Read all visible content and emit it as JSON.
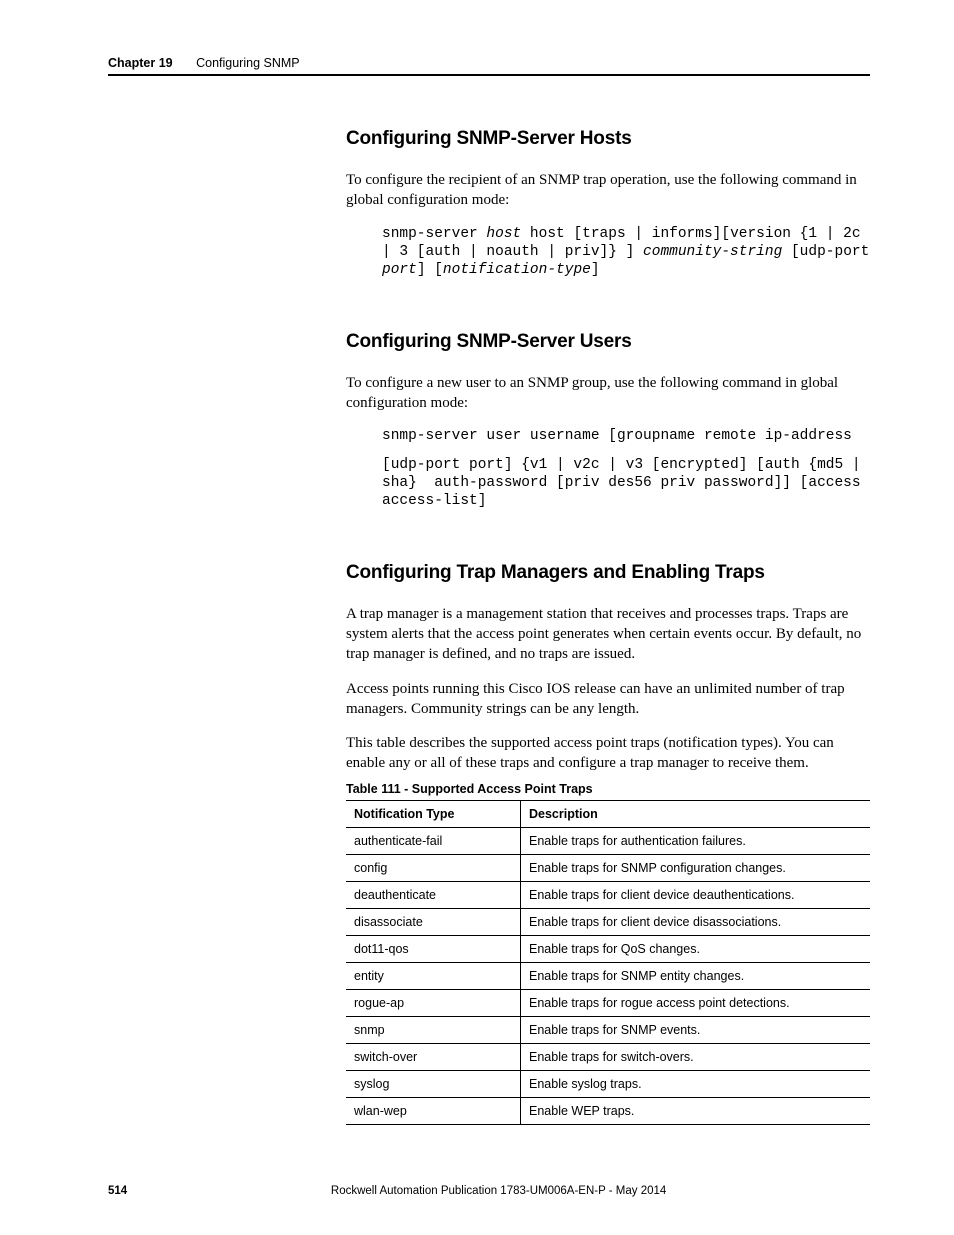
{
  "header": {
    "chapter_label": "Chapter 19",
    "chapter_title": "Configuring SNMP"
  },
  "sections": {
    "hosts": {
      "heading": "Configuring SNMP-Server Hosts",
      "intro": "To configure the recipient of an SNMP trap operation, use the following command in global configuration mode:",
      "code_plain1": "snmp-server ",
      "code_it1": "host",
      "code_plain2": " host [traps | informs][version {1 | 2c | 3 [auth | noauth | priv]} ] ",
      "code_it2": "community-string",
      "code_plain3": " [udp-port ",
      "code_it3": "port",
      "code_plain4": "] [",
      "code_it4": "notification-type",
      "code_plain5": "]"
    },
    "users": {
      "heading": "Configuring SNMP-Server Users",
      "intro": "To configure a new user to an SNMP group, use the following command in global configuration mode:",
      "code_line1": "snmp-server user username [groupname remote ip-address",
      "code_line2": "[udp-port port] {v1 | v2c | v3 [encrypted] [auth {md5 | sha}  auth-password [priv des56 priv password]] [access access-list]"
    },
    "traps": {
      "heading": "Configuring Trap Managers and Enabling Traps",
      "para1": "A trap manager is a management station that receives and processes traps. Traps are system alerts that the access point generates when certain events occur. By default, no trap manager is defined, and no traps are issued.",
      "para2": "Access points running this Cisco IOS release can have an unlimited number of trap managers. Community strings can be any length.",
      "para3": "This table describes the supported access point traps (notification types). You can enable any or all of these traps and configure a trap manager to receive them.",
      "table_caption": "Table 111 - Supported Access Point Traps",
      "col1": "Notification Type",
      "col2": "Description",
      "rows": [
        {
          "type": "authenticate-fail",
          "desc": "Enable traps for authentication failures."
        },
        {
          "type": "config",
          "desc": "Enable traps for SNMP configuration changes."
        },
        {
          "type": "deauthenticate",
          "desc": "Enable traps for client device deauthentications."
        },
        {
          "type": "disassociate",
          "desc": "Enable traps for client device disassociations."
        },
        {
          "type": "dot11-qos",
          "desc": "Enable traps for QoS changes."
        },
        {
          "type": "entity",
          "desc": "Enable traps for SNMP entity changes."
        },
        {
          "type": "rogue-ap",
          "desc": "Enable traps for rogue access point detections."
        },
        {
          "type": "snmp",
          "desc": "Enable traps for SNMP events."
        },
        {
          "type": "switch-over",
          "desc": "Enable traps for switch-overs."
        },
        {
          "type": "syslog",
          "desc": "Enable syslog traps."
        },
        {
          "type": "wlan-wep",
          "desc": "Enable WEP traps."
        }
      ]
    }
  },
  "footer": {
    "page_number": "514",
    "publication": "Rockwell Automation Publication 1783-UM006A-EN-P - May 2014"
  }
}
